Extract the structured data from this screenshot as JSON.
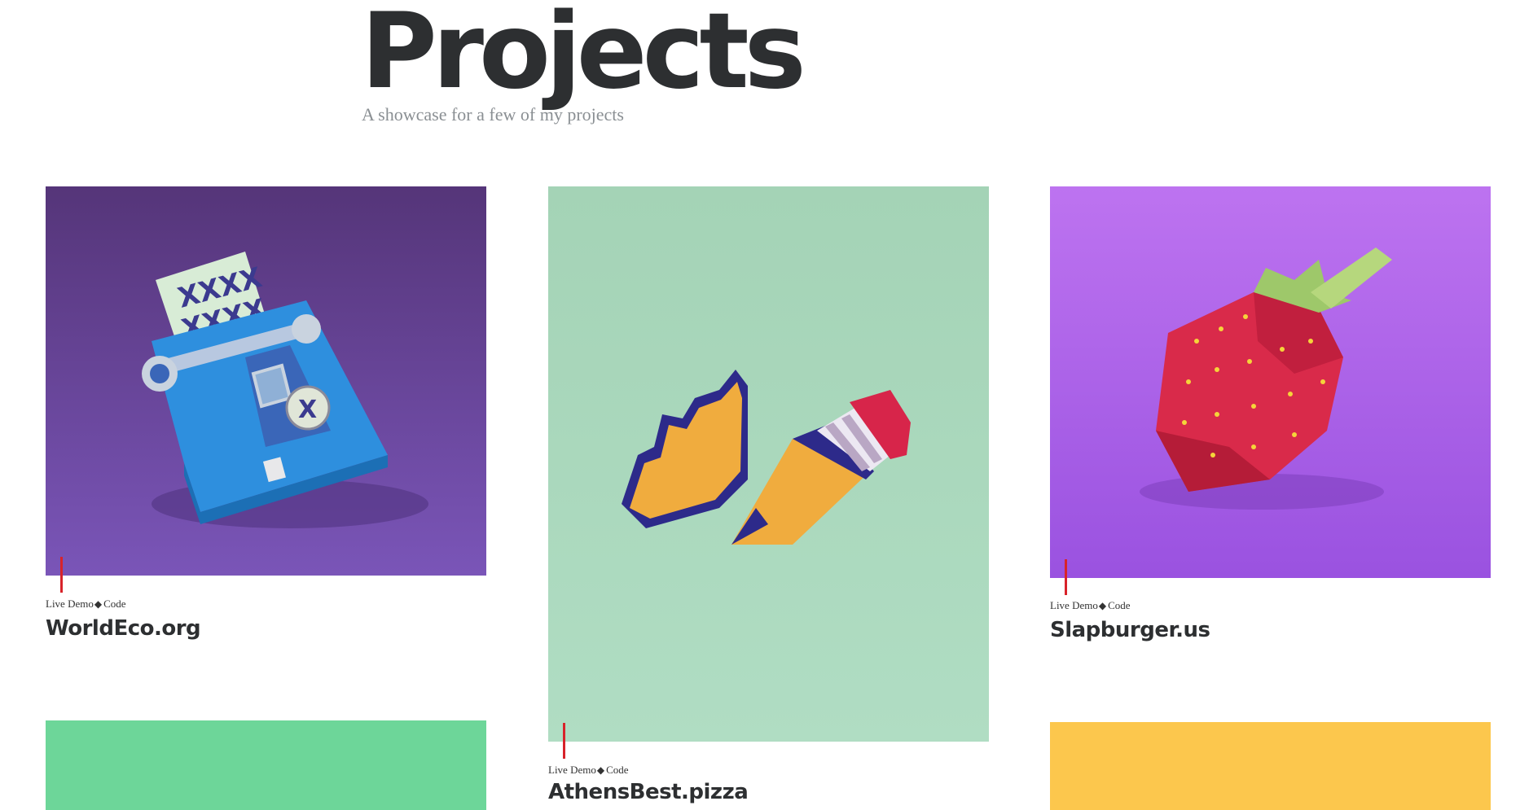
{
  "header": {
    "title": "Projects",
    "subtitle": "A showcase for a few of my projects"
  },
  "projects": [
    {
      "name": "WorldEco.org",
      "live_demo_label": "Live Demo",
      "separator": "◆",
      "code_label": "Code",
      "image_subject": "paper-craft blue typewriter on purple background",
      "bg_color": "#6a47a8"
    },
    {
      "name": "AthensBest.pizza",
      "live_demo_label": "Live Demo",
      "separator": "◆",
      "code_label": "Code",
      "image_subject": "paper-craft pencil and shavings on mint background",
      "bg_color": "#a6d8bd"
    },
    {
      "name": "Slapburger.us",
      "live_demo_label": "Live Demo",
      "separator": "◆",
      "code_label": "Code",
      "image_subject": "paper-craft strawberry on violet background",
      "bg_color": "#a660e8"
    },
    {
      "image_subject": "green background",
      "bg_color": "#6dd699"
    },
    {
      "image_subject": "yellow background",
      "bg_color": "#fcc74d"
    }
  ],
  "colors": {
    "accent": "#d8232a",
    "heading": "#2d2f31",
    "subtitle": "#8a8f93"
  }
}
